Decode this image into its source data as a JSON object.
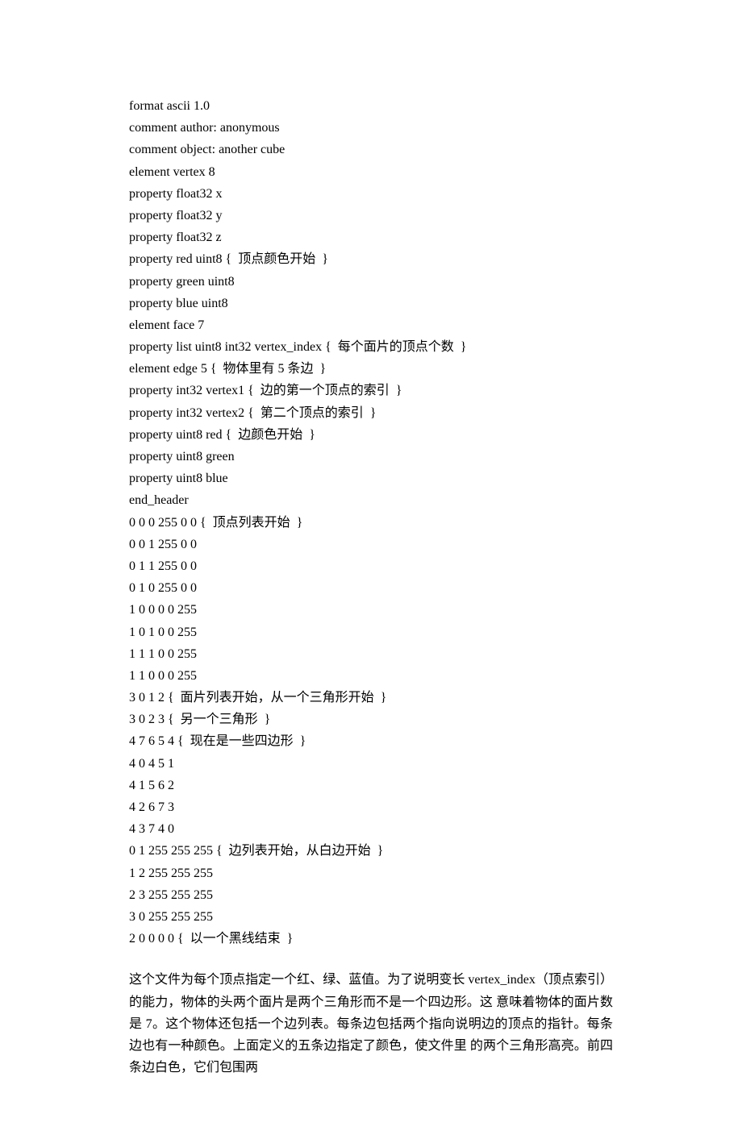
{
  "code_lines": [
    "format ascii 1.0",
    "comment author: anonymous",
    "comment object: another cube",
    "element vertex 8",
    "property float32 x",
    "property float32 y",
    "property float32 z",
    "property red uint8 {  顶点颜色开始  }",
    "property green uint8",
    "property blue uint8",
    "element face 7",
    "property list uint8 int32 vertex_index {  每个面片的顶点个数  }",
    "element edge 5 {  物体里有 5 条边  }",
    "property int32 vertex1 {  边的第一个顶点的索引  }",
    "property int32 vertex2 {  第二个顶点的索引  }",
    "property uint8 red {  边颜色开始  }",
    "property uint8 green",
    "property uint8 blue",
    "end_header",
    "0 0 0 255 0 0 {  顶点列表开始  }",
    "0 0 1 255 0 0",
    "0 1 1 255 0 0",
    "0 1 0 255 0 0",
    "1 0 0 0 0 255",
    "1 0 1 0 0 255",
    "1 1 1 0 0 255",
    "1 1 0 0 0 255",
    "3 0 1 2 {  面片列表开始，从一个三角形开始  }",
    "3 0 2 3 {  另一个三角形  }",
    "4 7 6 5 4 {  现在是一些四边形  }",
    "4 0 4 5 1",
    "4 1 5 6 2",
    "4 2 6 7 3",
    "4 3 7 4 0",
    "0 1 255 255 255 {  边列表开始，从白边开始  }",
    "1 2 255 255 255",
    "2 3 255 255 255",
    "3 0 255 255 255",
    "2 0 0 0 0 {  以一个黑线结束  }"
  ],
  "paragraph": "这个文件为每个顶点指定一个红、绿、蓝值。为了说明变长 vertex_index（顶点索引）的能力，物体的头两个面片是两个三角形而不是一个四边形。这 意味着物体的面片数是 7。这个物体还包括一个边列表。每条边包括两个指向说明边的顶点的指针。每条边也有一种颜色。上面定义的五条边指定了颜色，使文件里 的两个三角形高亮。前四条边白色，它们包围两"
}
